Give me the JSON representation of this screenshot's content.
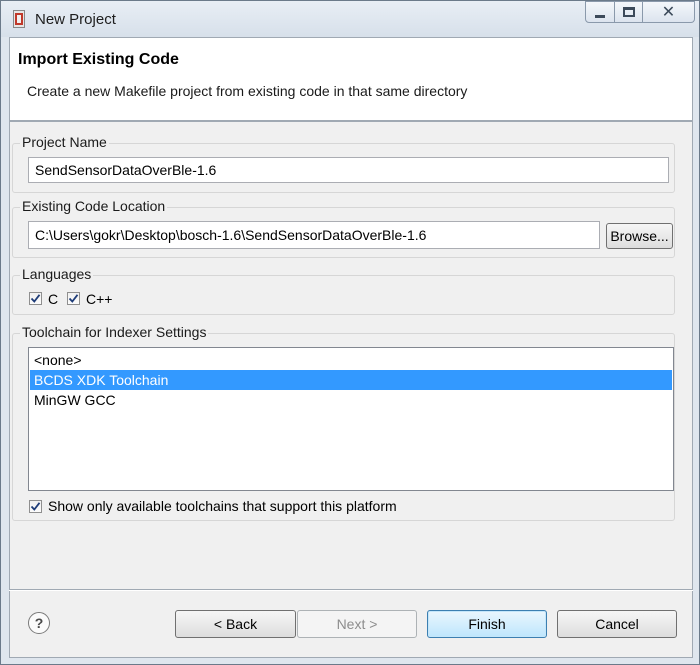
{
  "window": {
    "title": "New Project",
    "app_icon": "eclipse-new-project-icon",
    "controls": {
      "minimize": "minimize-icon",
      "maximize": "maximize-icon",
      "close": "✕"
    }
  },
  "header": {
    "title": "Import Existing Code",
    "description": "Create a new Makefile project from existing code in that same directory"
  },
  "project_name": {
    "label": "Project Name",
    "value": "SendSensorDataOverBle-1.6"
  },
  "code_location": {
    "label": "Existing Code Location",
    "value": "C:\\Users\\gokr\\Desktop\\bosch-1.6\\SendSensorDataOverBle-1.6",
    "browse_label": "Browse..."
  },
  "languages": {
    "label": "Languages",
    "options": [
      {
        "label": "C",
        "checked": true
      },
      {
        "label": "C++",
        "checked": true
      }
    ]
  },
  "toolchain": {
    "label": "Toolchain for Indexer Settings",
    "items": [
      "<none>",
      "BCDS XDK Toolchain",
      "MinGW GCC"
    ],
    "selected": "BCDS XDK Toolchain",
    "filter_label": "Show only available toolchains that support this platform",
    "filter_checked": true
  },
  "footer": {
    "help_icon": "?",
    "back_label": "< Back",
    "next_label": "Next >",
    "finish_label": "Finish",
    "cancel_label": "Cancel"
  },
  "colors": {
    "selection": "#3399ff",
    "window_frame": "#dfe6ee",
    "default_button": "#bee6fd"
  }
}
